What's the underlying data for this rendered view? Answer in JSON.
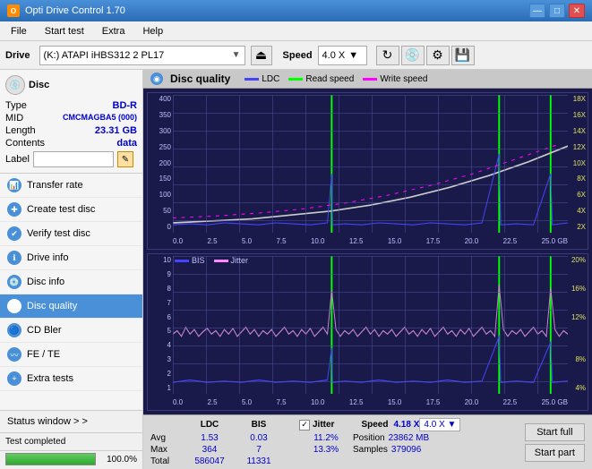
{
  "app": {
    "title": "Opti Drive Control 1.70",
    "icon": "O"
  },
  "titlebar": {
    "minimize": "—",
    "maximize": "□",
    "close": "✕"
  },
  "menubar": {
    "items": [
      "File",
      "Start test",
      "Extra",
      "Help"
    ]
  },
  "drivebar": {
    "label": "Drive",
    "drive_text": "(K:)  ATAPI iHBS312  2 PL17",
    "speed_label": "Speed",
    "speed_value": "4.0 X",
    "eject_icon": "⏏"
  },
  "disc": {
    "header": "Disc",
    "fields": [
      {
        "label": "Type",
        "value": "BD-R"
      },
      {
        "label": "MID",
        "value": "CMCMAGBA5 (000)"
      },
      {
        "label": "Length",
        "value": "23.31 GB"
      },
      {
        "label": "Contents",
        "value": "data"
      }
    ],
    "label_placeholder": "",
    "label_btn": "✎"
  },
  "nav": {
    "items": [
      {
        "id": "transfer-rate",
        "label": "Transfer rate",
        "active": false
      },
      {
        "id": "create-test-disc",
        "label": "Create test disc",
        "active": false
      },
      {
        "id": "verify-test-disc",
        "label": "Verify test disc",
        "active": false
      },
      {
        "id": "drive-info",
        "label": "Drive info",
        "active": false
      },
      {
        "id": "disc-info",
        "label": "Disc info",
        "active": false
      },
      {
        "id": "disc-quality",
        "label": "Disc quality",
        "active": true
      },
      {
        "id": "cd-bler",
        "label": "CD Bler",
        "active": false
      },
      {
        "id": "fe-te",
        "label": "FE / TE",
        "active": false
      },
      {
        "id": "extra-tests",
        "label": "Extra tests",
        "active": false
      }
    ]
  },
  "status_window": {
    "label": "Status window > >"
  },
  "progress": {
    "value": 100,
    "percent_text": "100.0%",
    "status_text": "Test completed"
  },
  "chart": {
    "title": "Disc quality",
    "top": {
      "legend": [
        {
          "name": "LDC",
          "color": "#0000ff"
        },
        {
          "name": "Read speed",
          "color": "#00ff00"
        },
        {
          "name": "Write speed",
          "color": "#ff00ff"
        }
      ],
      "y_left": [
        "400",
        "350",
        "300",
        "250",
        "200",
        "150",
        "100",
        "50",
        "0"
      ],
      "y_right": [
        "18X",
        "16X",
        "14X",
        "12X",
        "10X",
        "8X",
        "6X",
        "4X",
        "2X"
      ],
      "x_labels": [
        "0.0",
        "2.5",
        "5.0",
        "7.5",
        "10.0",
        "12.5",
        "15.0",
        "17.5",
        "20.0",
        "22.5",
        "25.0 GB"
      ]
    },
    "bottom": {
      "legend": [
        {
          "name": "BIS",
          "color": "#0000ff"
        },
        {
          "name": "Jitter",
          "color": "#ff00ff"
        }
      ],
      "y_left": [
        "10",
        "9",
        "8",
        "7",
        "6",
        "5",
        "4",
        "3",
        "2",
        "1"
      ],
      "y_right": [
        "20%",
        "16%",
        "12%",
        "8%",
        "4%"
      ],
      "x_labels": [
        "0.0",
        "2.5",
        "5.0",
        "7.5",
        "10.0",
        "12.5",
        "15.0",
        "17.5",
        "20.0",
        "22.5",
        "25.0 GB"
      ]
    }
  },
  "stats": {
    "columns": [
      "LDC",
      "BIS",
      "",
      "Jitter",
      "Speed",
      ""
    ],
    "rows": {
      "avg": {
        "label": "Avg",
        "ldc": "1.53",
        "bis": "0.03",
        "jitter": "11.2%",
        "speed_label": "Position",
        "speed_val": "23862 MB"
      },
      "max": {
        "label": "Max",
        "ldc": "364",
        "bis": "7",
        "jitter": "13.3%",
        "speed_label": "Samples",
        "speed_val": "379096"
      },
      "total": {
        "label": "Total",
        "ldc": "586047",
        "bis": "11331",
        "jitter": "",
        "speed_label": "",
        "speed_val": ""
      }
    },
    "speed_result": "4.18 X",
    "speed_select": "4.0 X",
    "jitter_checked": true,
    "jitter_label": "Jitter"
  },
  "buttons": {
    "start_full": "Start full",
    "start_part": "Start part"
  },
  "colors": {
    "accent_blue": "#4a90d9",
    "chart_bg": "#1a1a4a",
    "ldc_color": "#4444ff",
    "read_speed_color": "#00ff00",
    "write_speed_color": "#ff00ff",
    "bis_color": "#4444ff",
    "jitter_color": "#ff88ff",
    "green_spike": "#00ff00"
  }
}
